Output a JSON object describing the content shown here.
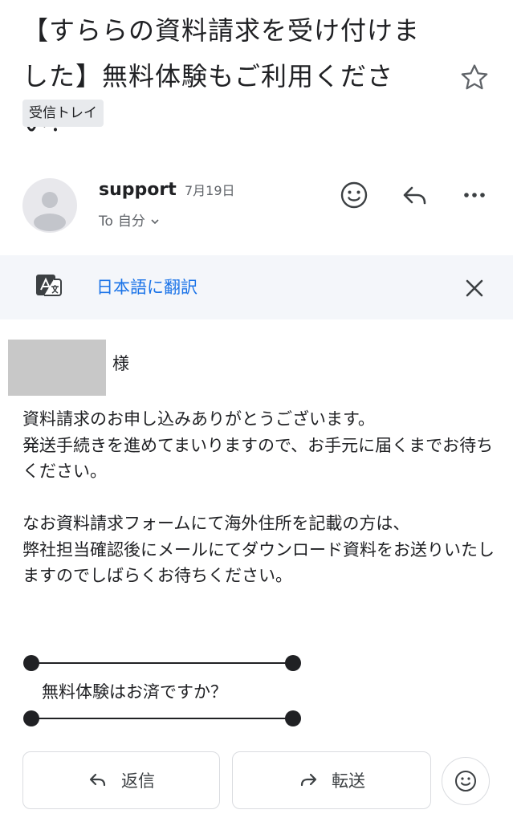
{
  "email": {
    "subject": "【すららの資料請求を受け付けました】無料体験もご利用ください！",
    "label": "受信トレイ",
    "sender": "support",
    "date": "7月19日",
    "to_prefix": "To",
    "to_value": "自分",
    "translate_text": "日本語に翻訳",
    "salutation_suffix": "様",
    "body": "資料請求のお申し込みありがとうございます。\n発送手続きを進めてまいりますので、お手元に届くまでお待ちください。\n\nなお資料請求フォームにて海外住所を記載の方は、\n弊社担当確認後にメールにてダウンロード資料をお送りいたしますのでしばらくお待ちください。",
    "trial_question": "無料体験はお済ですか？"
  },
  "actions": {
    "reply_label": "返信",
    "forward_label": "転送"
  },
  "icons": {
    "star": "star-icon",
    "emoji": "emoji-icon",
    "reply": "reply-icon",
    "more": "more-icon",
    "translate": "translate-icon",
    "close": "close-icon",
    "forward": "forward-icon",
    "chevron": "chevron-down-icon"
  },
  "colors": {
    "accent": "#1a73e8",
    "translate_bar": "#f4f6fa"
  }
}
